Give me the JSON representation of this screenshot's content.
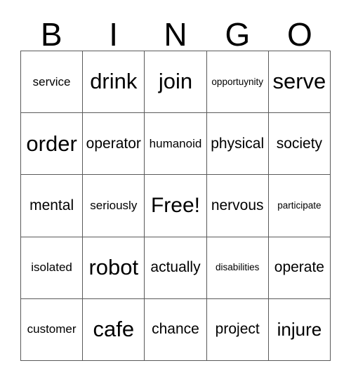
{
  "card": {
    "header_letters": [
      "B",
      "I",
      "N",
      "G",
      "O"
    ],
    "free_space_label": "Free!",
    "columns": 5,
    "rows": 5,
    "colors": {
      "background": "#ffffff",
      "text": "#000000",
      "grid_line": "#5a5a5a"
    },
    "rows_data": [
      [
        {
          "word": "service",
          "size": "sm"
        },
        {
          "word": "drink",
          "size": "xl"
        },
        {
          "word": "join",
          "size": "xl"
        },
        {
          "word": "opportuynity",
          "size": "xs"
        },
        {
          "word": "serve",
          "size": "xl"
        }
      ],
      [
        {
          "word": "order",
          "size": "xl"
        },
        {
          "word": "operator",
          "size": "md"
        },
        {
          "word": "humanoid",
          "size": "sm"
        },
        {
          "word": "physical",
          "size": "md"
        },
        {
          "word": "society",
          "size": "md"
        }
      ],
      [
        {
          "word": "mental",
          "size": "md"
        },
        {
          "word": "seriously",
          "size": "sm"
        },
        {
          "word": "Free!",
          "size": "free"
        },
        {
          "word": "nervous",
          "size": "md"
        },
        {
          "word": "participate",
          "size": "xs"
        }
      ],
      [
        {
          "word": "isolated",
          "size": "sm"
        },
        {
          "word": "robot",
          "size": "xl"
        },
        {
          "word": "actually",
          "size": "md"
        },
        {
          "word": "disabilities",
          "size": "xs"
        },
        {
          "word": "operate",
          "size": "md"
        }
      ],
      [
        {
          "word": "customer",
          "size": "sm"
        },
        {
          "word": "cafe",
          "size": "xl"
        },
        {
          "word": "chance",
          "size": "md"
        },
        {
          "word": "project",
          "size": "md"
        },
        {
          "word": "injure",
          "size": "lg"
        }
      ]
    ]
  }
}
